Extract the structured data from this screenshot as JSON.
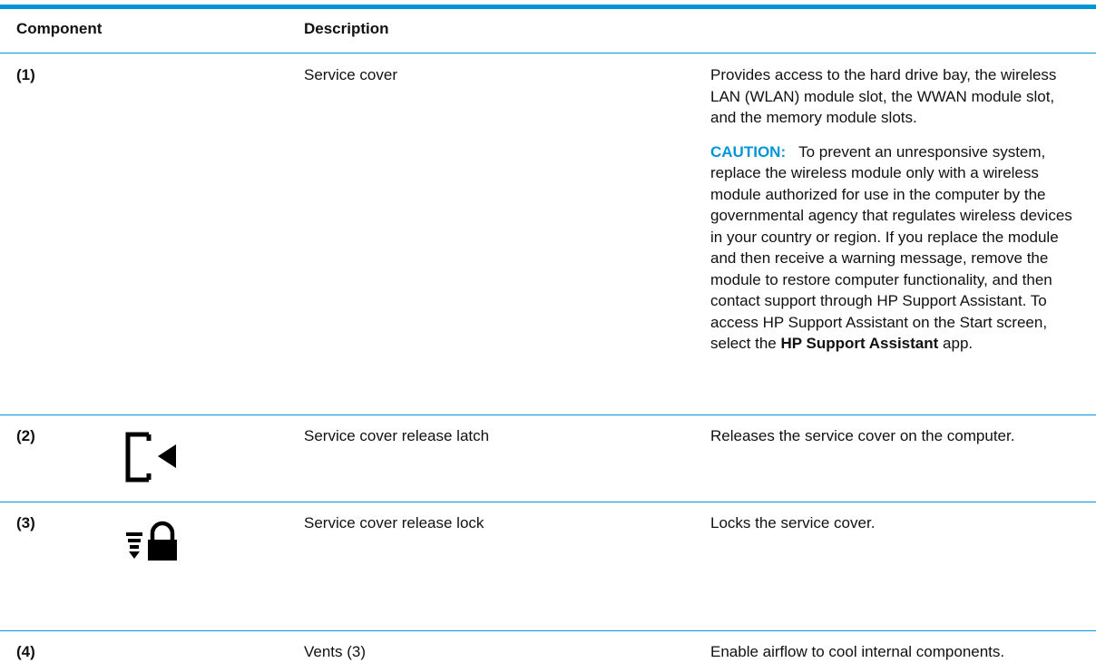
{
  "table": {
    "headers": {
      "component": "Component",
      "description": "Description"
    },
    "rows": [
      {
        "number": "(1)",
        "name": "Service cover",
        "description": "Provides access to the hard drive bay, the wireless LAN (WLAN) module slot, the WWAN module slot, and the memory module slots.",
        "caution_label": "CAUTION:",
        "caution_text": "To prevent an unresponsive system, replace the wireless module only with a wireless module authorized for use in the computer by the governmental agency that regulates wireless devices in your country or region. If you replace the module and then receive a warning message, remove the module to restore computer functionality, and then contact support through HP Support Assistant. To access HP Support Assistant on the Start screen, select the ",
        "caution_app": "HP Support Assistant",
        "caution_end": " app."
      },
      {
        "number": "(2)",
        "icon": "service-cover-release-latch-icon",
        "name": "Service cover release latch",
        "description": "Releases the service cover on the computer."
      },
      {
        "number": "(3)",
        "icon": "service-cover-lock-icon",
        "name": "Service cover release lock",
        "description": "Locks the service cover."
      },
      {
        "number": "(4)",
        "name": "Vents (3)",
        "description": "Enable airflow to cool internal components."
      }
    ]
  },
  "colors": {
    "accent": "#0096d6",
    "text": "#111111"
  }
}
